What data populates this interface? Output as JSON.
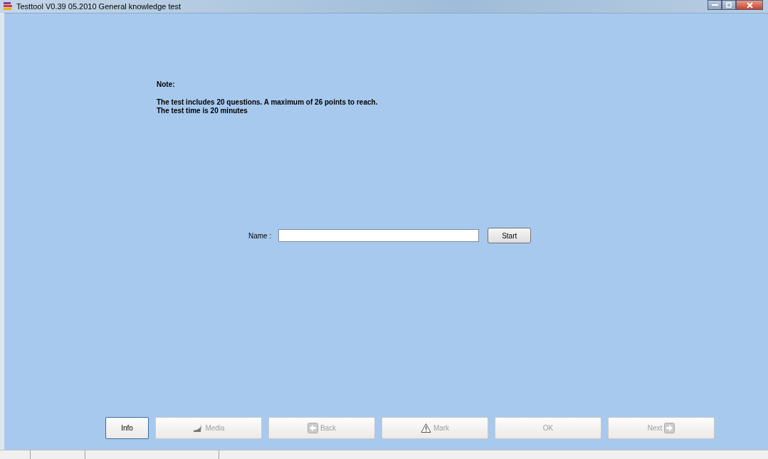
{
  "window": {
    "title": "Testtool V0.39 05.2010 General knowledge test"
  },
  "note": {
    "heading": "Note:",
    "lines": [
      "The test includes 20 questions. A maximum of 26 points to reach.",
      "The test time is 20 minutes"
    ]
  },
  "name_field": {
    "label": "Name :"
  },
  "start_button": {
    "label": "Start"
  },
  "buttons": [
    {
      "label": "Info",
      "kind": "plain",
      "disabled": false,
      "focused": true
    },
    {
      "label": "Media",
      "kind": "media",
      "disabled": true,
      "focused": false
    },
    {
      "label": "Back",
      "kind": "back",
      "disabled": true,
      "focused": false
    },
    {
      "label": "Mark",
      "kind": "mark",
      "disabled": true,
      "focused": false
    },
    {
      "label": "OK",
      "kind": "plain",
      "disabled": true,
      "focused": false
    },
    {
      "label": "Next",
      "kind": "next",
      "disabled": true,
      "focused": false
    }
  ]
}
